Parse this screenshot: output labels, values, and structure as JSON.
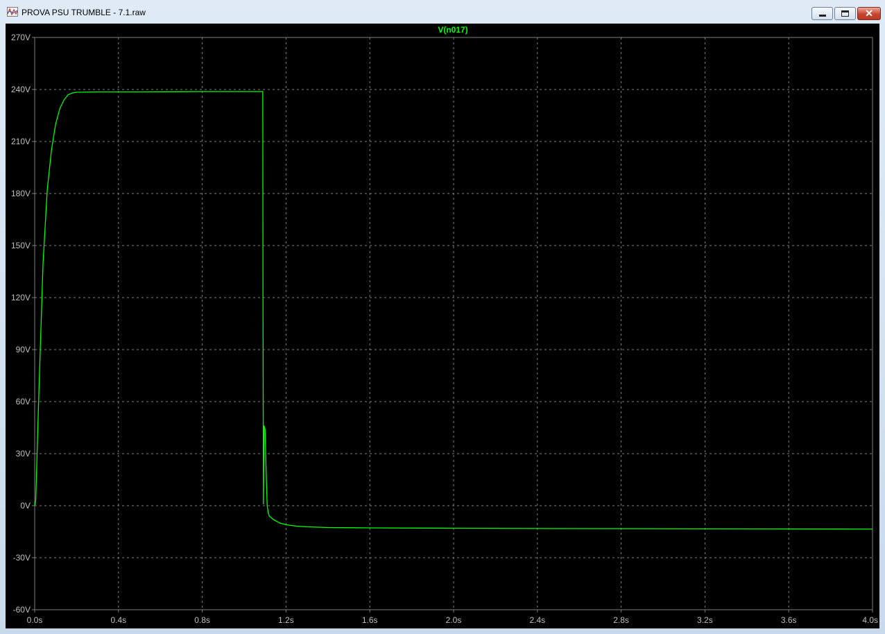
{
  "window": {
    "title": "PROVA PSU TRUMBLE - 7.1.raw",
    "minimize_icon": "minimize-icon",
    "maximize_icon": "maximize-icon",
    "close_icon": "close-icon",
    "close_glyph": "✕"
  },
  "colors": {
    "background": "#000000",
    "trace": "#00ff00",
    "grid": "#808080",
    "axis_text": "#c0c0c0"
  },
  "chart_data": {
    "type": "line",
    "title": "V(n017)",
    "xlabel": "",
    "ylabel": "",
    "xlim": [
      0,
      4.0
    ],
    "ylim": [
      -60,
      270
    ],
    "grid": true,
    "x_ticks": [
      0,
      0.4,
      0.8,
      1.2,
      1.6,
      2.0,
      2.4,
      2.8,
      3.2,
      3.6,
      4.0
    ],
    "x_tick_labels": [
      "0.0s",
      "0.4s",
      "0.8s",
      "1.2s",
      "1.6s",
      "2.0s",
      "2.4s",
      "2.8s",
      "3.2s",
      "3.6s",
      "4.0s"
    ],
    "y_ticks": [
      270,
      240,
      210,
      180,
      150,
      120,
      90,
      60,
      30,
      0,
      -30,
      -60
    ],
    "y_tick_labels": [
      "270V",
      "240V",
      "210V",
      "180V",
      "150V",
      "120V",
      "90V",
      "60V",
      "30V",
      "0V",
      "-30V",
      "-60V"
    ],
    "series": [
      {
        "name": "V(n017)",
        "x": [
          0,
          0.005,
          0.02,
          0.04,
          0.06,
          0.08,
          0.1,
          0.12,
          0.14,
          0.16,
          0.18,
          0.2,
          0.25,
          0.3,
          0.5,
          0.8,
          1.0,
          1.089,
          1.09,
          1.092,
          1.095,
          1.1,
          1.105,
          1.11,
          1.115,
          1.12,
          1.14,
          1.17,
          1.2,
          1.25,
          1.3,
          1.4,
          1.6,
          2.0,
          2.5,
          3.0,
          3.5,
          4.0
        ],
        "y": [
          0,
          3,
          65,
          140,
          182,
          205,
          220,
          229,
          234,
          237,
          238,
          238.4,
          238.5,
          238.6,
          238.6,
          238.8,
          238.8,
          238.8,
          120,
          1,
          46,
          44,
          20,
          0,
          -4,
          -6,
          -8,
          -10,
          -11,
          -11.8,
          -12.2,
          -12.6,
          -12.8,
          -13,
          -13.2,
          -13.3,
          -13.4,
          -13.5
        ]
      }
    ]
  }
}
